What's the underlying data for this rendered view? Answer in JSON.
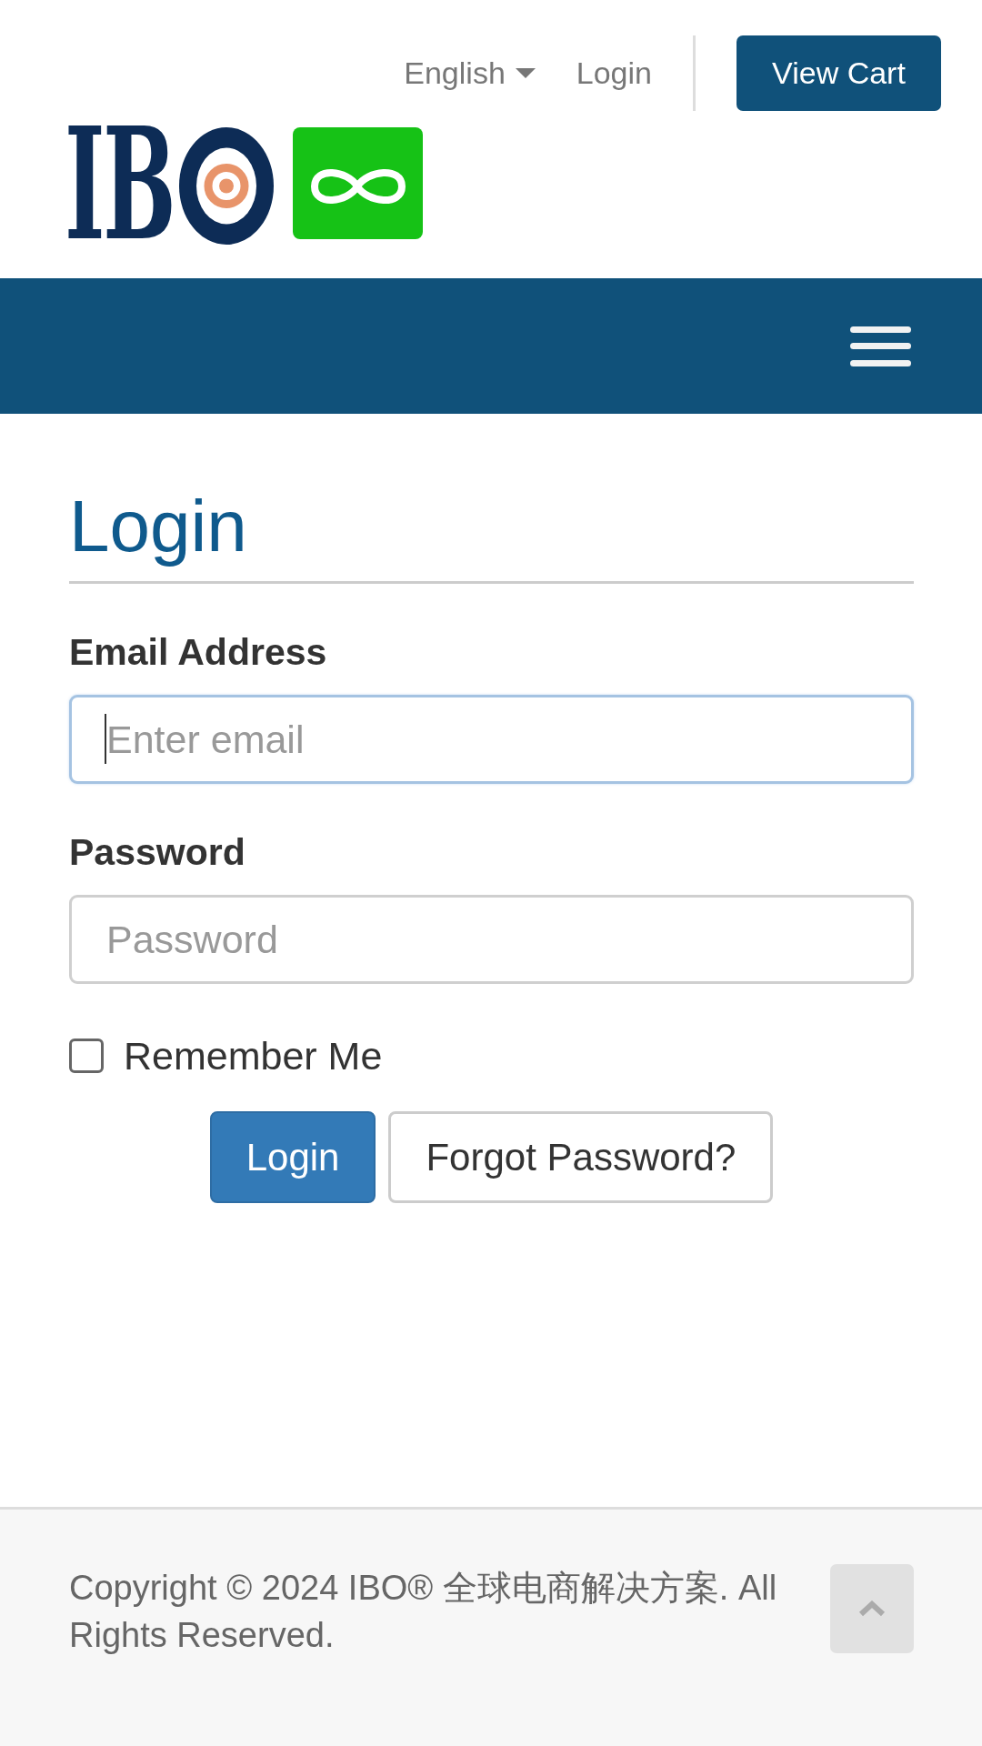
{
  "header": {
    "language": "English",
    "login_link": "Login",
    "cart_button": "View Cart",
    "logo_text": "IB"
  },
  "page": {
    "title": "Login"
  },
  "form": {
    "fields": [
      {
        "label": "Email Address",
        "placeholder": "Enter email",
        "focused": true
      },
      {
        "label": "Password",
        "placeholder": "Password",
        "focused": false
      }
    ],
    "remember": {
      "label": "Remember Me",
      "checked": false
    },
    "buttons": [
      {
        "label": "Login",
        "kind": "primary"
      },
      {
        "label": "Forgot Password?",
        "kind": "default"
      }
    ]
  },
  "footer": {
    "copyright": "Copyright © 2024 IBO® 全球电商解决方案. All Rights Reserved."
  }
}
